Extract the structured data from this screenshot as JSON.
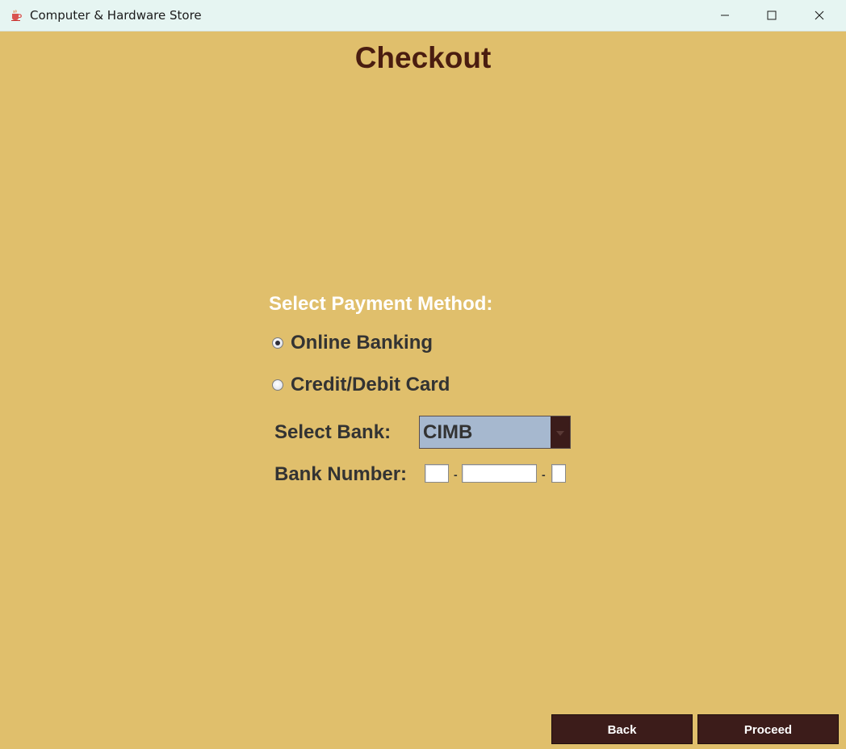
{
  "window": {
    "title": "Computer & Hardware Store",
    "icon": "coffee-cup-icon",
    "controls": [
      "minimize-icon",
      "maximize-icon",
      "close-icon"
    ]
  },
  "page": {
    "heading": "Checkout"
  },
  "payment": {
    "label": "Select Payment Method:",
    "options": [
      {
        "label": "Online Banking",
        "selected": true
      },
      {
        "label": "Credit/Debit Card",
        "selected": false
      }
    ]
  },
  "bank": {
    "label": "Select Bank:",
    "selected": "CIMB"
  },
  "bank_number": {
    "label": "Bank Number:",
    "separator": "-",
    "parts": [
      "",
      "",
      ""
    ]
  },
  "buttons": {
    "back": "Back",
    "proceed": "Proceed"
  },
  "colors": {
    "background": "#e0bf6c",
    "heading": "#4a1d10",
    "button": "#3c1c1a",
    "titlebar": "#e6f5f2",
    "select": "#a6b8cf"
  }
}
